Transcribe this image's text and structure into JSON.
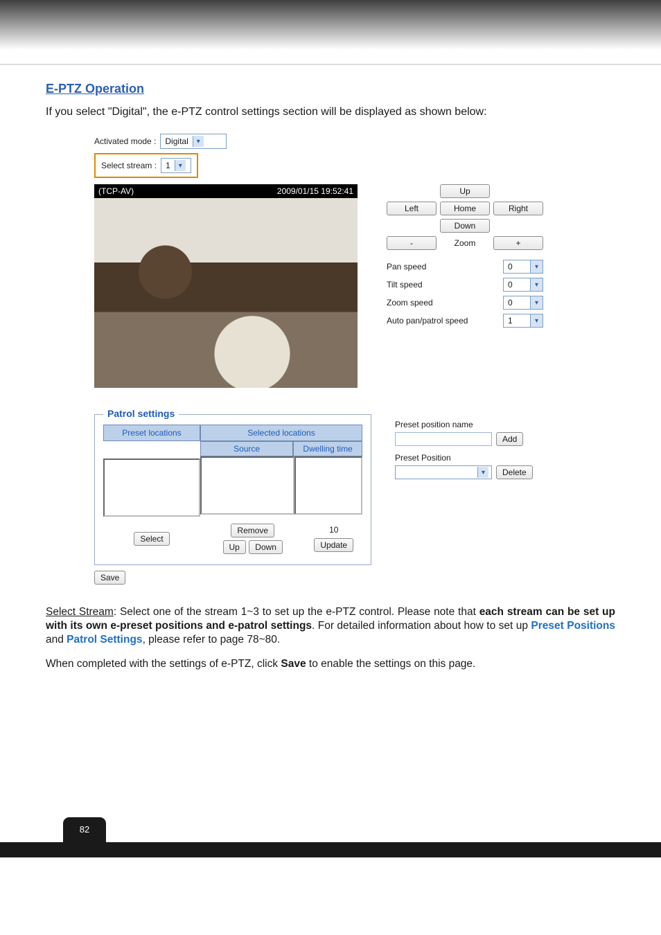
{
  "header": {
    "title": "E-PTZ Operation"
  },
  "intro": "If you select \"Digital\", the e-PTZ control settings section will be displayed as shown below:",
  "mode_select": {
    "label": "Activated mode :",
    "value": "Digital"
  },
  "stream_select": {
    "label": "Select stream :",
    "value": "1"
  },
  "video": {
    "protocol": "(TCP-AV)",
    "timestamp": "2009/01/15 19:52:41"
  },
  "controls": {
    "up": "Up",
    "left": "Left",
    "home": "Home",
    "right": "Right",
    "down": "Down",
    "zoom_out": "-",
    "zoom_label": "Zoom",
    "zoom_in": "+"
  },
  "speeds": {
    "pan_label": "Pan speed",
    "pan_value": "0",
    "tilt_label": "Tilt speed",
    "tilt_value": "0",
    "zoom_label": "Zoom speed",
    "zoom_value": "0",
    "auto_label": "Auto pan/patrol speed",
    "auto_value": "1"
  },
  "patrol": {
    "legend": "Patrol settings",
    "preset_locations_header": "Preset locations",
    "selected_locations_header": "Selected locations",
    "source_header": "Source",
    "dwell_header": "Dwelling time",
    "select_btn": "Select",
    "remove_btn": "Remove",
    "up_btn": "Up",
    "down_btn": "Down",
    "dwell_value": "10",
    "update_btn": "Update"
  },
  "preset": {
    "name_label": "Preset position name",
    "add_btn": "Add",
    "position_label": "Preset Position",
    "delete_btn": "Delete"
  },
  "save_btn": "Save",
  "body": {
    "select_stream_u": "Select Stream",
    "p1a": ": Select one of the stream 1~3 to set up the e-PTZ control. Please note that ",
    "p1b_bold": "each stream can be set up with its own e-preset positions and e-patrol settings",
    "p1c": ". For detailed information about how to set up ",
    "preset_link": "Preset Positions",
    "p1d": " and ",
    "patrol_link": "Patrol Settings",
    "p1e": ", please refer to page 78~80.",
    "p2a": "When completed with the settings of e-PTZ, click ",
    "p2b_bold": "Save",
    "p2c": " to enable the settings on this page."
  },
  "page_number": "82"
}
